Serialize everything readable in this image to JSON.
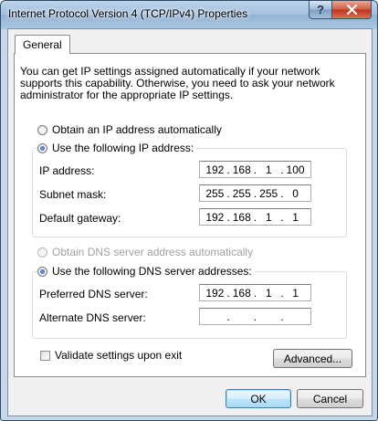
{
  "window": {
    "title": "Internet Protocol Version 4 (TCP/IPv4) Properties",
    "help_glyph": "?"
  },
  "tabs": [
    {
      "label": "General",
      "selected": true
    }
  ],
  "description": "You can get IP settings assigned automatically if your network supports this capability. Otherwise, you need to ask your network administrator for the appropriate IP settings.",
  "ip_mode": {
    "auto": {
      "label": "Obtain an IP address automatically",
      "selected": false
    },
    "manual": {
      "label": "Use the following IP address:",
      "selected": true
    }
  },
  "ip_fields": [
    {
      "label": "IP address:",
      "octets": [
        "192",
        "168",
        "1",
        "100"
      ]
    },
    {
      "label": "Subnet mask:",
      "octets": [
        "255",
        "255",
        "255",
        "0"
      ]
    },
    {
      "label": "Default gateway:",
      "octets": [
        "192",
        "168",
        "1",
        "1"
      ]
    }
  ],
  "dns_mode": {
    "auto": {
      "label": "Obtain DNS server address automatically",
      "selected": false,
      "disabled": true
    },
    "manual": {
      "label": "Use the following DNS server addresses:",
      "selected": true
    }
  },
  "dns_fields": [
    {
      "label": "Preferred DNS server:",
      "octets": [
        "192",
        "168",
        "1",
        "1"
      ]
    },
    {
      "label": "Alternate DNS server:",
      "octets": [
        "",
        "",
        "",
        ""
      ]
    }
  ],
  "validate": {
    "label": "Validate settings upon exit",
    "checked": false
  },
  "buttons": {
    "advanced": "Advanced...",
    "ok": "OK",
    "cancel": "Cancel"
  },
  "icons": {
    "close": "close-icon",
    "help": "help-icon"
  }
}
